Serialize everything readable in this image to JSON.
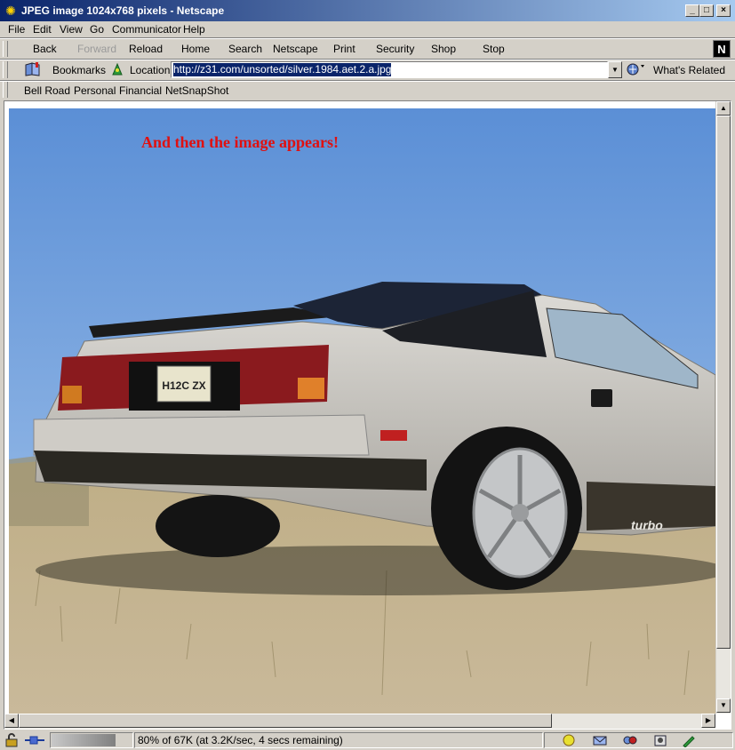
{
  "window": {
    "title": "JPEG image 1024x768 pixels - Netscape",
    "minimize_glyph": "_",
    "maximize_glyph": "□",
    "close_glyph": "×"
  },
  "menu": {
    "items": [
      "File",
      "Edit",
      "View",
      "Go",
      "Communicator",
      "Help"
    ]
  },
  "navigation": {
    "back": "Back",
    "forward": "Forward",
    "reload": "Reload",
    "home": "Home",
    "search": "Search",
    "netscape": "Netscape",
    "print": "Print",
    "security": "Security",
    "shop": "Shop",
    "stop": "Stop",
    "logo": "N"
  },
  "location_bar": {
    "bookmarks_label": "Bookmarks",
    "location_label": "Location:",
    "url": "http://z31.com/unsorted/silver.1984.aet.2.a.jpg",
    "whats_related_label": "What's Related"
  },
  "personal_toolbar": {
    "items": [
      "Bell Road",
      "Personal",
      "Financial",
      "NetSnapShot"
    ]
  },
  "content": {
    "overlay_text": "And then the image appears!",
    "license_plate": "H12C ZX",
    "side_decal": "turbo",
    "sky_color": "#5b8fd6",
    "car_color": "#c6c3bd"
  },
  "status": {
    "progress_fraction": 0.8,
    "text": "80% of 67K (at 3.2K/sec, 4 secs remaining)"
  }
}
